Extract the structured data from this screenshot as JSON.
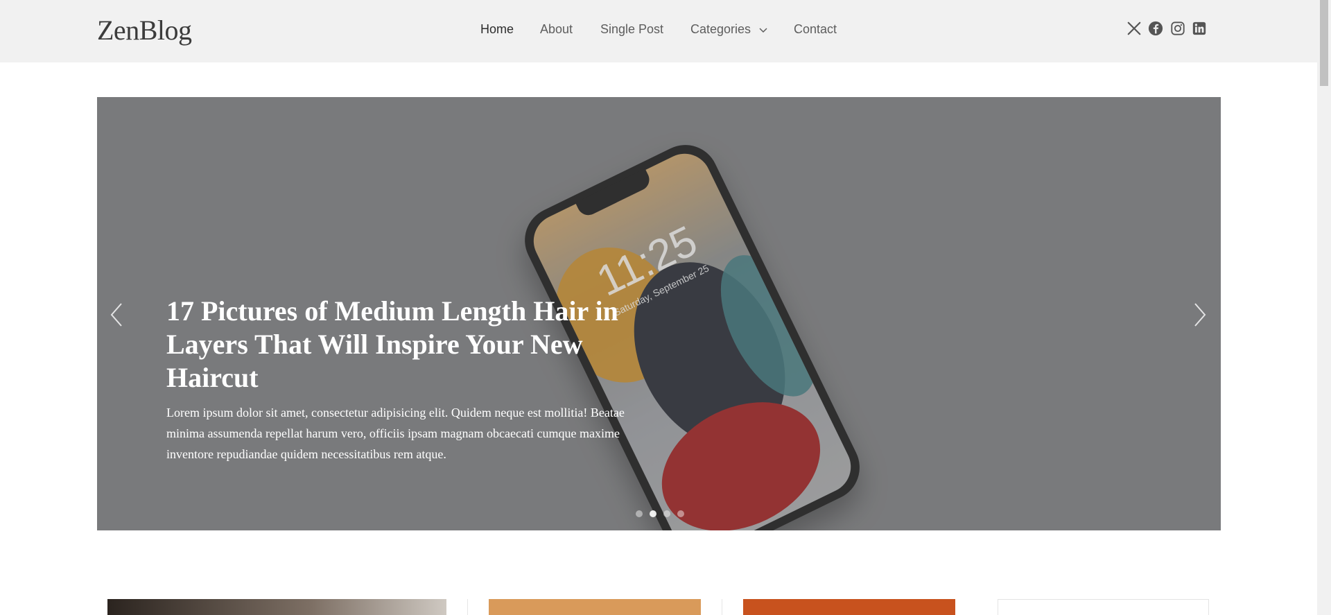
{
  "brand": {
    "logo": "ZenBlog"
  },
  "nav": {
    "items": [
      {
        "label": "Home"
      },
      {
        "label": "About"
      },
      {
        "label": "Single Post"
      },
      {
        "label": "Categories"
      },
      {
        "label": "Contact"
      }
    ]
  },
  "social": [
    "x-icon",
    "facebook-icon",
    "instagram-icon",
    "linkedin-icon"
  ],
  "hero": {
    "title": "17 Pictures of Medium Length Hair in Layers That Will Inspire Your New Haircut",
    "excerpt": "Lorem ipsum dolor sit amet, consectetur adipisicing elit. Quidem neque est mollitia! Beatae minima assumenda repellat harum vero, officiis ipsam magnam obcaecati cumque maxime inventore repudiandae quidem necessitatibus rem atque.",
    "phone_time": "11:25",
    "phone_date": "Saturday, September 25",
    "slides": 4,
    "active_slide": 1
  },
  "colors": {
    "header_bg": "#f1f1f1",
    "hero_bg": "#7d7e80",
    "text_light": "#ffffff"
  }
}
